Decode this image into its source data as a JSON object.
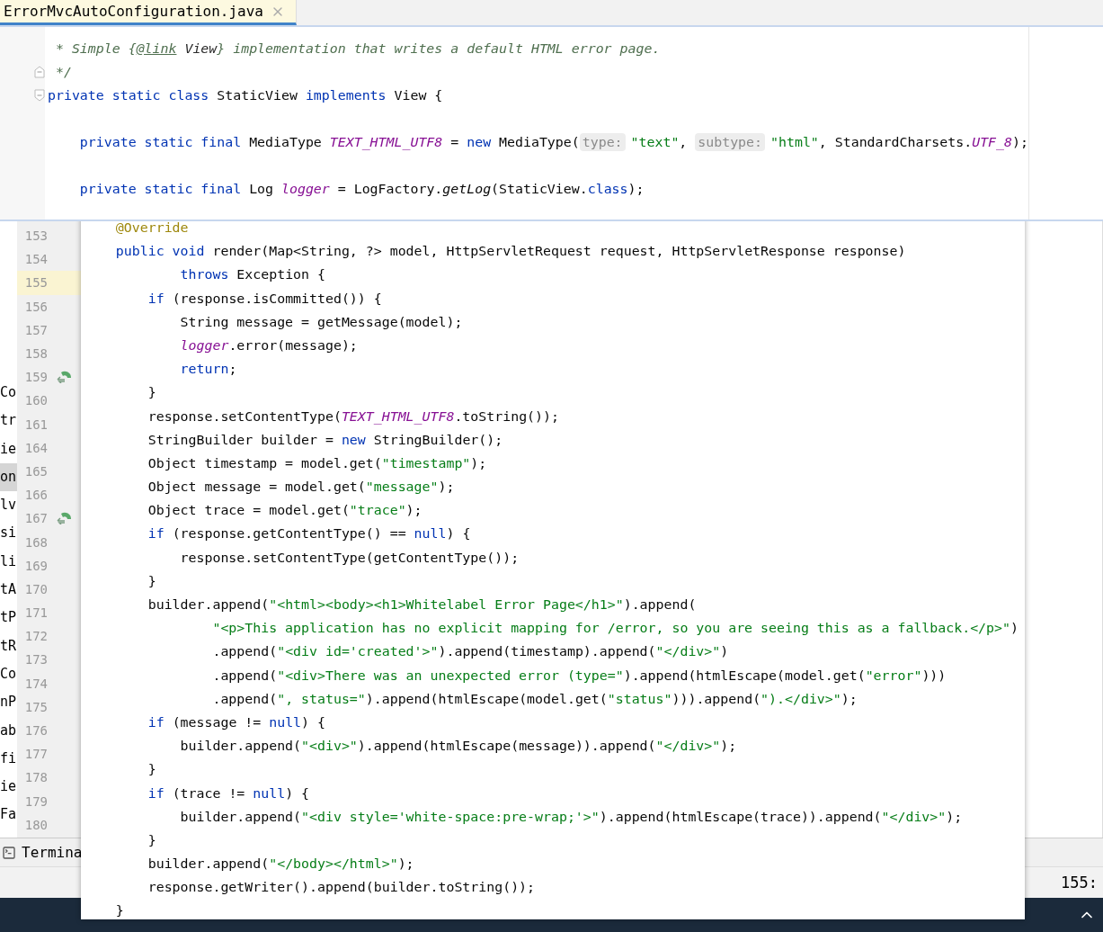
{
  "tab": {
    "label": "ErrorMvcAutoConfiguration.java",
    "selected": true
  },
  "project_items": [
    {
      "label": "Co",
      "selected": false
    },
    {
      "label": "tr",
      "selected": false
    },
    {
      "label": "ie",
      "selected": false
    },
    {
      "label": "on",
      "selected": true
    },
    {
      "label": "lv",
      "selected": false
    },
    {
      "label": "si",
      "selected": false
    },
    {
      "label": "li",
      "selected": false
    },
    {
      "label": "tA",
      "selected": false
    },
    {
      "label": "tP",
      "selected": false
    },
    {
      "label": "tR",
      "selected": false
    },
    {
      "label": "Co",
      "selected": false
    },
    {
      "label": "nP",
      "selected": false
    },
    {
      "label": "ab",
      "selected": false
    },
    {
      "label": "fi",
      "selected": false
    },
    {
      "label": "ie",
      "selected": false
    },
    {
      "label": "Fa",
      "selected": false
    }
  ],
  "gutter": [
    {
      "number": "153",
      "current": false,
      "override": false
    },
    {
      "number": "154",
      "current": false,
      "override": false
    },
    {
      "number": "155",
      "current": true,
      "override": false
    },
    {
      "number": "156",
      "current": false,
      "override": false
    },
    {
      "number": "157",
      "current": false,
      "override": false
    },
    {
      "number": "158",
      "current": false,
      "override": false
    },
    {
      "number": "159",
      "current": false,
      "override": true
    },
    {
      "number": "160",
      "current": false,
      "override": false
    },
    {
      "number": "161",
      "current": false,
      "override": false
    },
    {
      "number": "164",
      "current": false,
      "override": false
    },
    {
      "number": "165",
      "current": false,
      "override": false
    },
    {
      "number": "166",
      "current": false,
      "override": false
    },
    {
      "number": "167",
      "current": false,
      "override": true
    },
    {
      "number": "168",
      "current": false,
      "override": false
    },
    {
      "number": "169",
      "current": false,
      "override": false
    },
    {
      "number": "170",
      "current": false,
      "override": false
    },
    {
      "number": "171",
      "current": false,
      "override": false
    },
    {
      "number": "172",
      "current": false,
      "override": false
    },
    {
      "number": "173",
      "current": false,
      "override": false
    },
    {
      "number": "174",
      "current": false,
      "override": false
    },
    {
      "number": "175",
      "current": false,
      "override": false
    },
    {
      "number": "176",
      "current": false,
      "override": false
    },
    {
      "number": "177",
      "current": false,
      "override": false
    },
    {
      "number": "178",
      "current": false,
      "override": false
    },
    {
      "number": "179",
      "current": false,
      "override": false
    },
    {
      "number": "180",
      "current": false,
      "override": false
    }
  ],
  "sticky_header": [
    {
      "kind": "code",
      "fold_open": false,
      "fold_close": false,
      "tokens": [
        {
          "kind": "comment",
          "text": " * Simple {"
        },
        {
          "kind": "doctag",
          "text": "@link"
        },
        {
          "kind": "docref",
          "text": " View"
        },
        {
          "kind": "comment",
          "text": "} implementation that writes a default HTML error page."
        }
      ]
    },
    {
      "kind": "code",
      "fold_open": false,
      "fold_close": true,
      "tokens": [
        {
          "kind": "comment",
          "text": " */"
        }
      ]
    },
    {
      "kind": "code",
      "fold_open": true,
      "fold_close": false,
      "tokens": [
        {
          "kind": "keyword",
          "text": "private static class "
        },
        {
          "kind": "plain",
          "text": "StaticView "
        },
        {
          "kind": "keyword",
          "text": "implements "
        },
        {
          "kind": "plain",
          "text": "View {"
        }
      ]
    },
    {
      "kind": "blank"
    },
    {
      "kind": "code",
      "fold_open": false,
      "fold_close": false,
      "tokens": [
        {
          "kind": "keyword",
          "text": "    private static final "
        },
        {
          "kind": "plain",
          "text": "MediaType "
        },
        {
          "kind": "field",
          "text": "TEXT_HTML_UTF8"
        },
        {
          "kind": "plain",
          "text": " = "
        },
        {
          "kind": "keyword",
          "text": "new "
        },
        {
          "kind": "plain",
          "text": "MediaType("
        },
        {
          "kind": "hint",
          "text": "type:"
        },
        {
          "kind": "string",
          "text": "\"text\""
        },
        {
          "kind": "plain",
          "text": ", "
        },
        {
          "kind": "hint",
          "text": "subtype:"
        },
        {
          "kind": "string",
          "text": "\"html\""
        },
        {
          "kind": "plain",
          "text": ", StandardCharsets."
        },
        {
          "kind": "field",
          "text": "UTF_8"
        },
        {
          "kind": "plain",
          "text": ");"
        }
      ]
    },
    {
      "kind": "blank"
    },
    {
      "kind": "code",
      "fold_open": false,
      "fold_close": false,
      "tokens": [
        {
          "kind": "keyword",
          "text": "    private static final "
        },
        {
          "kind": "plain",
          "text": "Log "
        },
        {
          "kind": "field",
          "text": "logger"
        },
        {
          "kind": "plain",
          "text": " = LogFactory."
        },
        {
          "kind": "static_call",
          "text": "getLog"
        },
        {
          "kind": "plain",
          "text": "(StaticView."
        },
        {
          "kind": "keyword",
          "text": "class"
        },
        {
          "kind": "plain",
          "text": ");"
        }
      ]
    }
  ],
  "popup_code": [
    {
      "kind": "code",
      "tokens": [
        {
          "kind": "annotation",
          "text": "    @Override"
        }
      ]
    },
    {
      "kind": "code",
      "tokens": [
        {
          "kind": "keyword",
          "text": "    public void "
        },
        {
          "kind": "plain",
          "text": "render(Map<String, ?> model, HttpServletRequest request, HttpServletResponse response)"
        }
      ]
    },
    {
      "kind": "code",
      "tokens": [
        {
          "kind": "keyword",
          "text": "            throws "
        },
        {
          "kind": "plain",
          "text": "Exception {"
        }
      ]
    },
    {
      "kind": "code",
      "tokens": [
        {
          "kind": "keyword",
          "text": "        if "
        },
        {
          "kind": "plain",
          "text": "(response.isCommitted()) {"
        }
      ]
    },
    {
      "kind": "code",
      "tokens": [
        {
          "kind": "plain",
          "text": "            String message = getMessage(model);"
        }
      ]
    },
    {
      "kind": "code",
      "tokens": [
        {
          "kind": "field",
          "text": "            logger"
        },
        {
          "kind": "plain",
          "text": ".error(message);"
        }
      ]
    },
    {
      "kind": "code",
      "tokens": [
        {
          "kind": "keyword",
          "text": "            return"
        },
        {
          "kind": "plain",
          "text": ";"
        }
      ]
    },
    {
      "kind": "code",
      "tokens": [
        {
          "kind": "plain",
          "text": "        }"
        }
      ]
    },
    {
      "kind": "code",
      "tokens": [
        {
          "kind": "plain",
          "text": "        response.setContentType("
        },
        {
          "kind": "field",
          "text": "TEXT_HTML_UTF8"
        },
        {
          "kind": "plain",
          "text": ".toString());"
        }
      ]
    },
    {
      "kind": "code",
      "tokens": [
        {
          "kind": "plain",
          "text": "        StringBuilder builder = "
        },
        {
          "kind": "keyword",
          "text": "new "
        },
        {
          "kind": "plain",
          "text": "StringBuilder();"
        }
      ]
    },
    {
      "kind": "code",
      "tokens": [
        {
          "kind": "plain",
          "text": "        Object timestamp = model.get("
        },
        {
          "kind": "string",
          "text": "\"timestamp\""
        },
        {
          "kind": "plain",
          "text": ");"
        }
      ]
    },
    {
      "kind": "code",
      "tokens": [
        {
          "kind": "plain",
          "text": "        Object message = model.get("
        },
        {
          "kind": "string",
          "text": "\"message\""
        },
        {
          "kind": "plain",
          "text": ");"
        }
      ]
    },
    {
      "kind": "code",
      "tokens": [
        {
          "kind": "plain",
          "text": "        Object trace = model.get("
        },
        {
          "kind": "string",
          "text": "\"trace\""
        },
        {
          "kind": "plain",
          "text": ");"
        }
      ]
    },
    {
      "kind": "code",
      "tokens": [
        {
          "kind": "keyword",
          "text": "        if "
        },
        {
          "kind": "plain",
          "text": "(response.getContentType() == "
        },
        {
          "kind": "keyword",
          "text": "null"
        },
        {
          "kind": "plain",
          "text": ") {"
        }
      ]
    },
    {
      "kind": "code",
      "tokens": [
        {
          "kind": "plain",
          "text": "            response.setContentType(getContentType());"
        }
      ]
    },
    {
      "kind": "code",
      "tokens": [
        {
          "kind": "plain",
          "text": "        }"
        }
      ]
    },
    {
      "kind": "code",
      "tokens": [
        {
          "kind": "plain",
          "text": "        builder.append("
        },
        {
          "kind": "string",
          "text": "\"<html><body><h1>Whitelabel Error Page</h1>\""
        },
        {
          "kind": "plain",
          "text": ").append("
        }
      ]
    },
    {
      "kind": "code",
      "tokens": [
        {
          "kind": "string",
          "text": "                \"<p>This application has no explicit mapping for /error, so you are seeing this as a fallback.</p>\""
        },
        {
          "kind": "plain",
          "text": ")"
        }
      ]
    },
    {
      "kind": "code",
      "tokens": [
        {
          "kind": "plain",
          "text": "                .append("
        },
        {
          "kind": "string",
          "text": "\"<div id='created'>\""
        },
        {
          "kind": "plain",
          "text": ").append(timestamp).append("
        },
        {
          "kind": "string",
          "text": "\"</div>\""
        },
        {
          "kind": "plain",
          "text": ")"
        }
      ]
    },
    {
      "kind": "code",
      "tokens": [
        {
          "kind": "plain",
          "text": "                .append("
        },
        {
          "kind": "string",
          "text": "\"<div>There was an unexpected error (type=\""
        },
        {
          "kind": "plain",
          "text": ").append(htmlEscape(model.get("
        },
        {
          "kind": "string",
          "text": "\"error\""
        },
        {
          "kind": "plain",
          "text": ")))"
        }
      ]
    },
    {
      "kind": "code",
      "tokens": [
        {
          "kind": "plain",
          "text": "                .append("
        },
        {
          "kind": "string",
          "text": "\", status=\""
        },
        {
          "kind": "plain",
          "text": ").append(htmlEscape(model.get("
        },
        {
          "kind": "string",
          "text": "\"status\""
        },
        {
          "kind": "plain",
          "text": "))).append("
        },
        {
          "kind": "string",
          "text": "\").</div>\""
        },
        {
          "kind": "plain",
          "text": ");"
        }
      ]
    },
    {
      "kind": "code",
      "tokens": [
        {
          "kind": "keyword",
          "text": "        if "
        },
        {
          "kind": "plain",
          "text": "(message != "
        },
        {
          "kind": "keyword",
          "text": "null"
        },
        {
          "kind": "plain",
          "text": ") {"
        }
      ]
    },
    {
      "kind": "code",
      "tokens": [
        {
          "kind": "plain",
          "text": "            builder.append("
        },
        {
          "kind": "string",
          "text": "\"<div>\""
        },
        {
          "kind": "plain",
          "text": ").append(htmlEscape(message)).append("
        },
        {
          "kind": "string",
          "text": "\"</div>\""
        },
        {
          "kind": "plain",
          "text": ");"
        }
      ]
    },
    {
      "kind": "code",
      "tokens": [
        {
          "kind": "plain",
          "text": "        }"
        }
      ]
    },
    {
      "kind": "code",
      "tokens": [
        {
          "kind": "keyword",
          "text": "        if "
        },
        {
          "kind": "plain",
          "text": "(trace != "
        },
        {
          "kind": "keyword",
          "text": "null"
        },
        {
          "kind": "plain",
          "text": ") {"
        }
      ]
    },
    {
      "kind": "code",
      "tokens": [
        {
          "kind": "plain",
          "text": "            builder.append("
        },
        {
          "kind": "string",
          "text": "\"<div style='white-space:pre-wrap;'>\""
        },
        {
          "kind": "plain",
          "text": ").append(htmlEscape(trace)).append("
        },
        {
          "kind": "string",
          "text": "\"</div>\""
        },
        {
          "kind": "plain",
          "text": ");"
        }
      ]
    },
    {
      "kind": "code",
      "tokens": [
        {
          "kind": "plain",
          "text": "        }"
        }
      ]
    },
    {
      "kind": "code",
      "tokens": [
        {
          "kind": "plain",
          "text": "        builder.append("
        },
        {
          "kind": "string",
          "text": "\"</body></html>\""
        },
        {
          "kind": "plain",
          "text": ");"
        }
      ]
    },
    {
      "kind": "code",
      "tokens": [
        {
          "kind": "plain",
          "text": "        response.getWriter().append(builder.toString());"
        }
      ]
    },
    {
      "kind": "code",
      "tokens": [
        {
          "kind": "plain",
          "text": "    }"
        }
      ]
    }
  ],
  "terminal_tab": {
    "label": "Termina"
  },
  "status_bar": {
    "position": "155:"
  }
}
